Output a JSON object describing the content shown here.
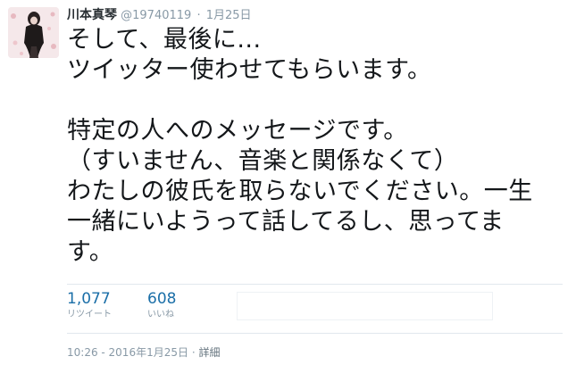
{
  "tweet": {
    "fullname": "川本真琴",
    "username": "@19740119",
    "separator": "·",
    "date_short": "1月25日",
    "text_lines": [
      "そして、最後に...",
      "ツイッター使わせてもらいます。",
      "",
      "特定の人へのメッセージです。",
      "（すいません、音楽と関係なくて）",
      "わたしの彼氏を取らないでください。一生",
      "一緒にいようって話してるし、思ってま",
      "す。"
    ],
    "stats": {
      "retweets": {
        "count": "1,077",
        "label": "リツイート"
      },
      "likes": {
        "count": "608",
        "label": "いいね"
      }
    },
    "footer": {
      "timestamp": "10:26 - 2016年1月25日",
      "separator": "·",
      "details": "詳細"
    }
  },
  "colors": {
    "link": "#1b6fa8",
    "meta": "#8899a6",
    "text": "#14171a",
    "divider": "#e1e8ed"
  }
}
